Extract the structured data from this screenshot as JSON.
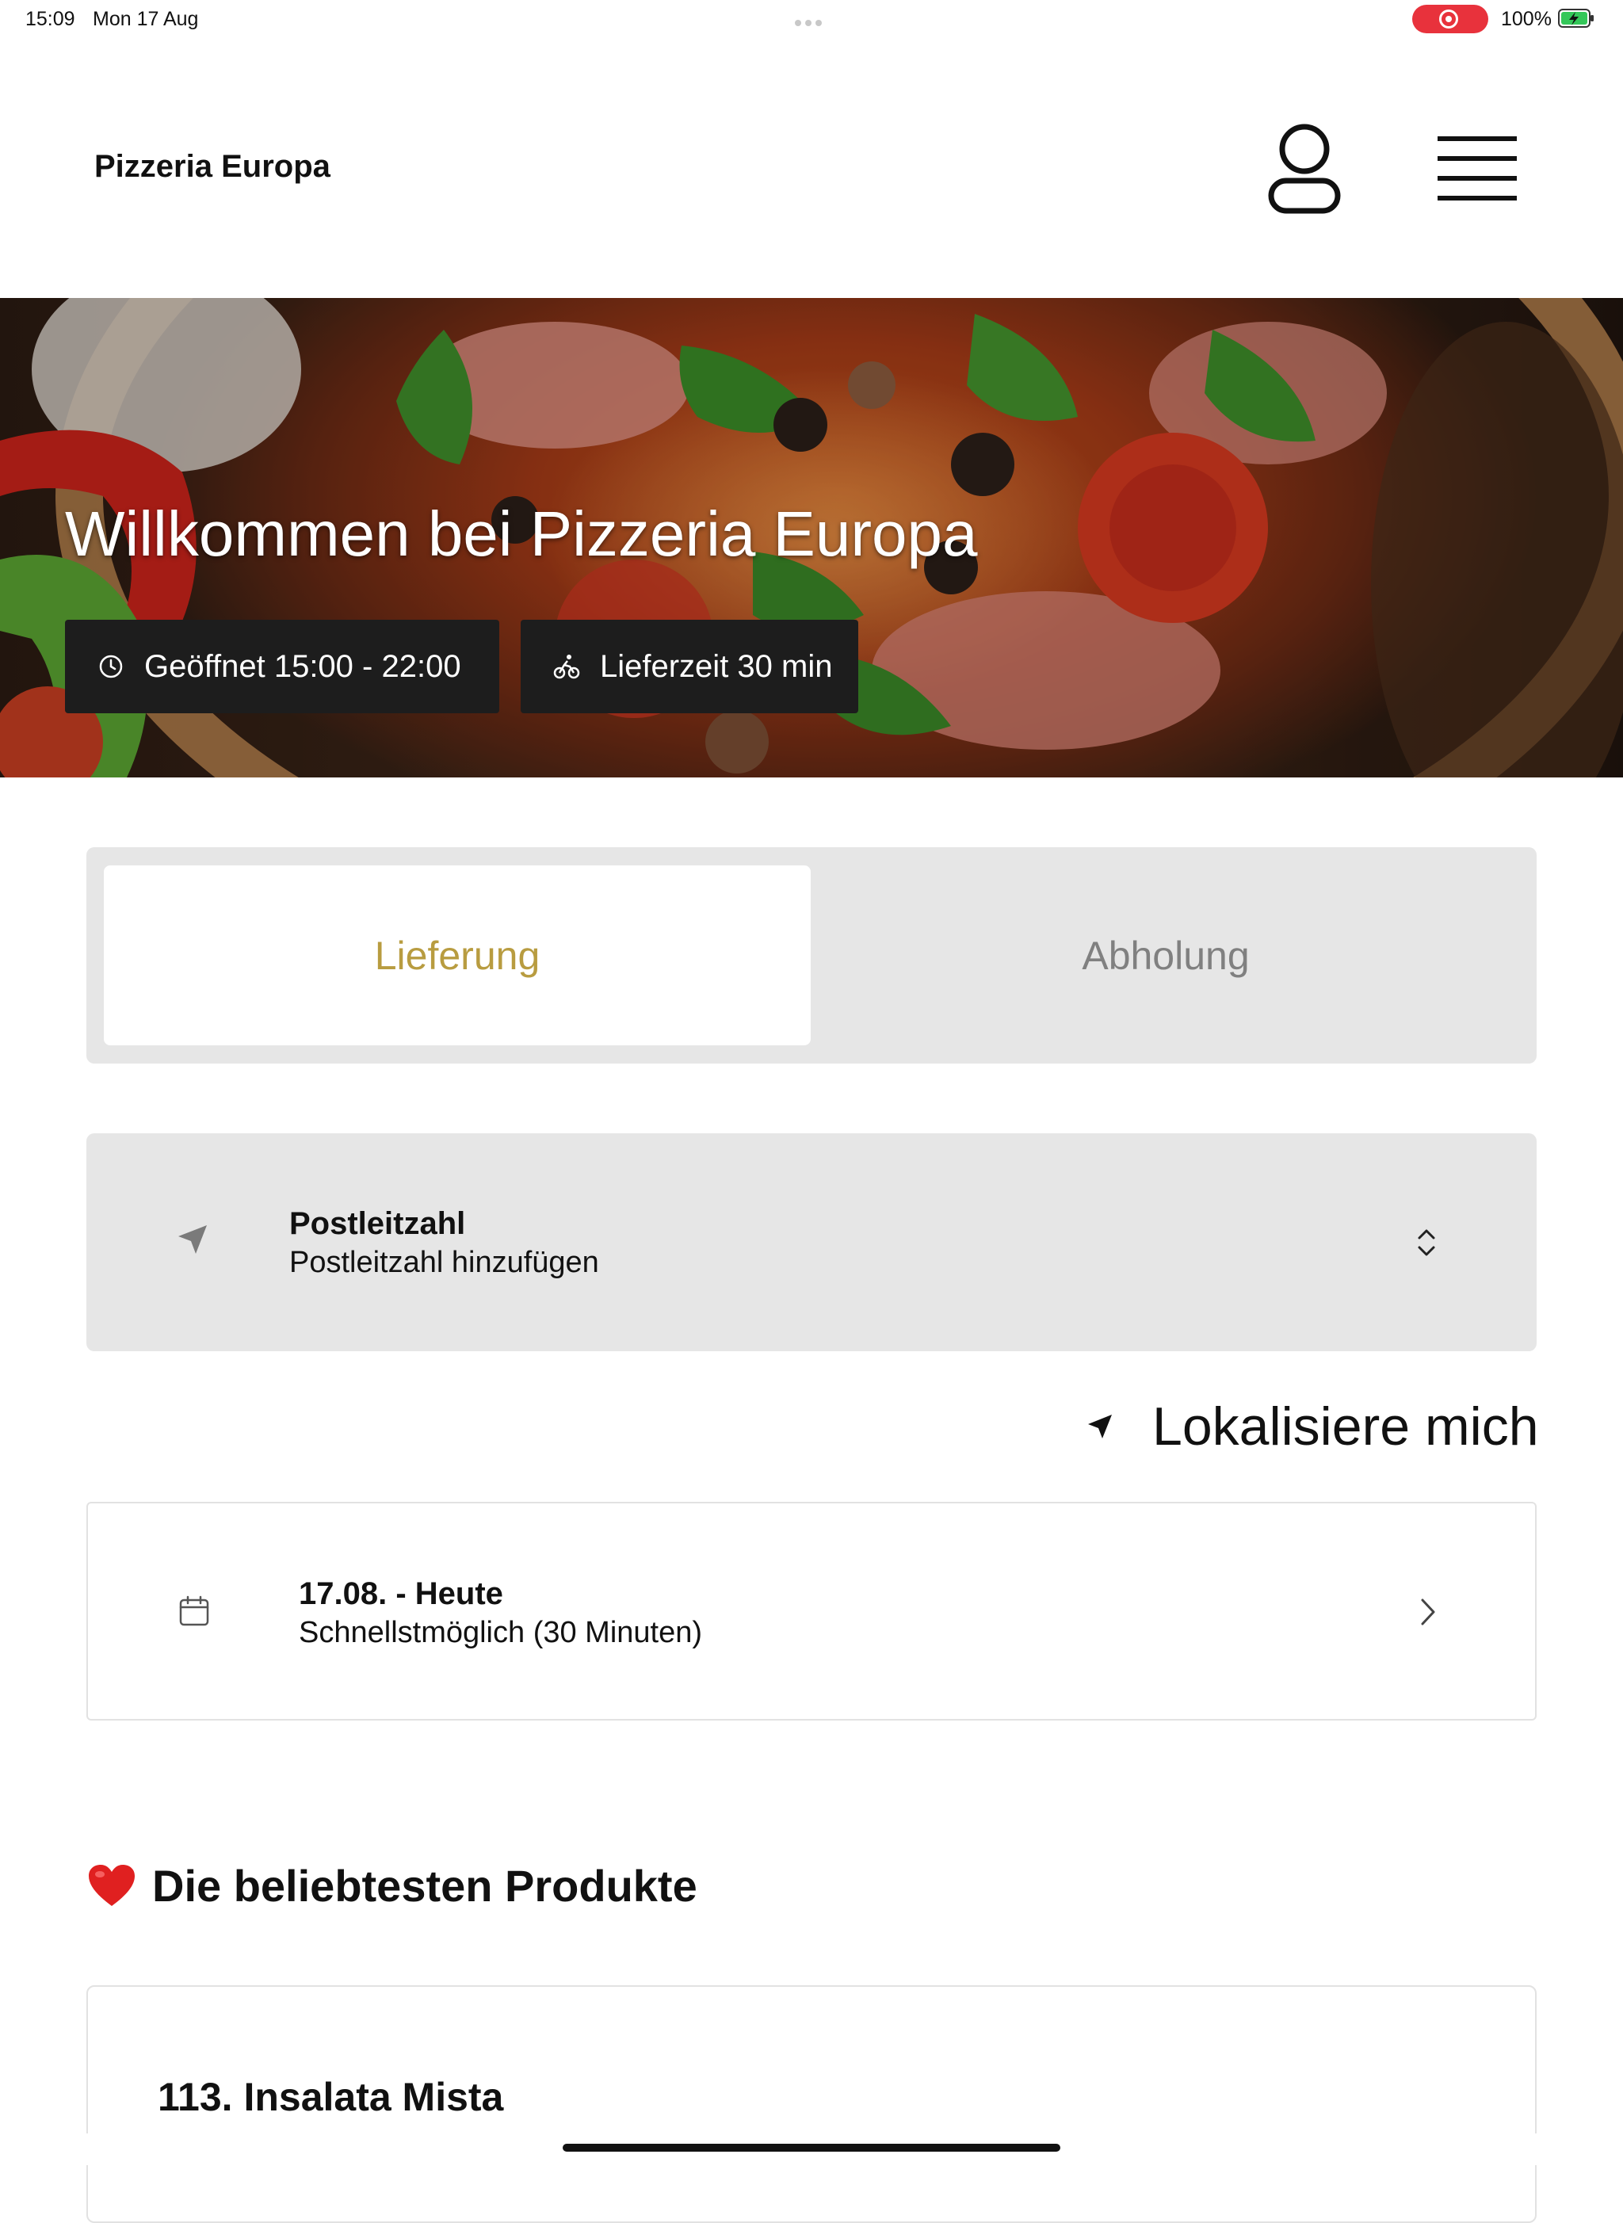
{
  "status_bar": {
    "time": "15:09",
    "date": "Mon 17 Aug",
    "battery": "100%",
    "record_color": "#e8323c"
  },
  "header": {
    "brand": "Pizzeria Europa",
    "icons": [
      "user-icon",
      "menu-icon"
    ]
  },
  "hero": {
    "title": "Willkommen bei Pizzeria Europa",
    "opening_hours": "Geöffnet 15:00 - 22:00",
    "delivery_time": "Lieferzeit 30 min",
    "icons": [
      "clock-icon",
      "bike-icon"
    ]
  },
  "order_mode": {
    "tabs": [
      {
        "label": "Lieferung",
        "selected": true
      },
      {
        "label": "Abholung",
        "selected": false
      }
    ],
    "accent_color": "#b89c40"
  },
  "postcode": {
    "label": "Postleitzahl",
    "value": "Postleitzahl hinzufügen"
  },
  "locate": {
    "label": "Lokalisiere mich"
  },
  "delivery_date": {
    "title": "17.08. - Heute",
    "subtitle": "Schnellstmöglich (30 Minuten)"
  },
  "popular": {
    "heading": "Die beliebtesten Produkte",
    "products": [
      {
        "name": "113. Insalata Mista"
      }
    ]
  }
}
